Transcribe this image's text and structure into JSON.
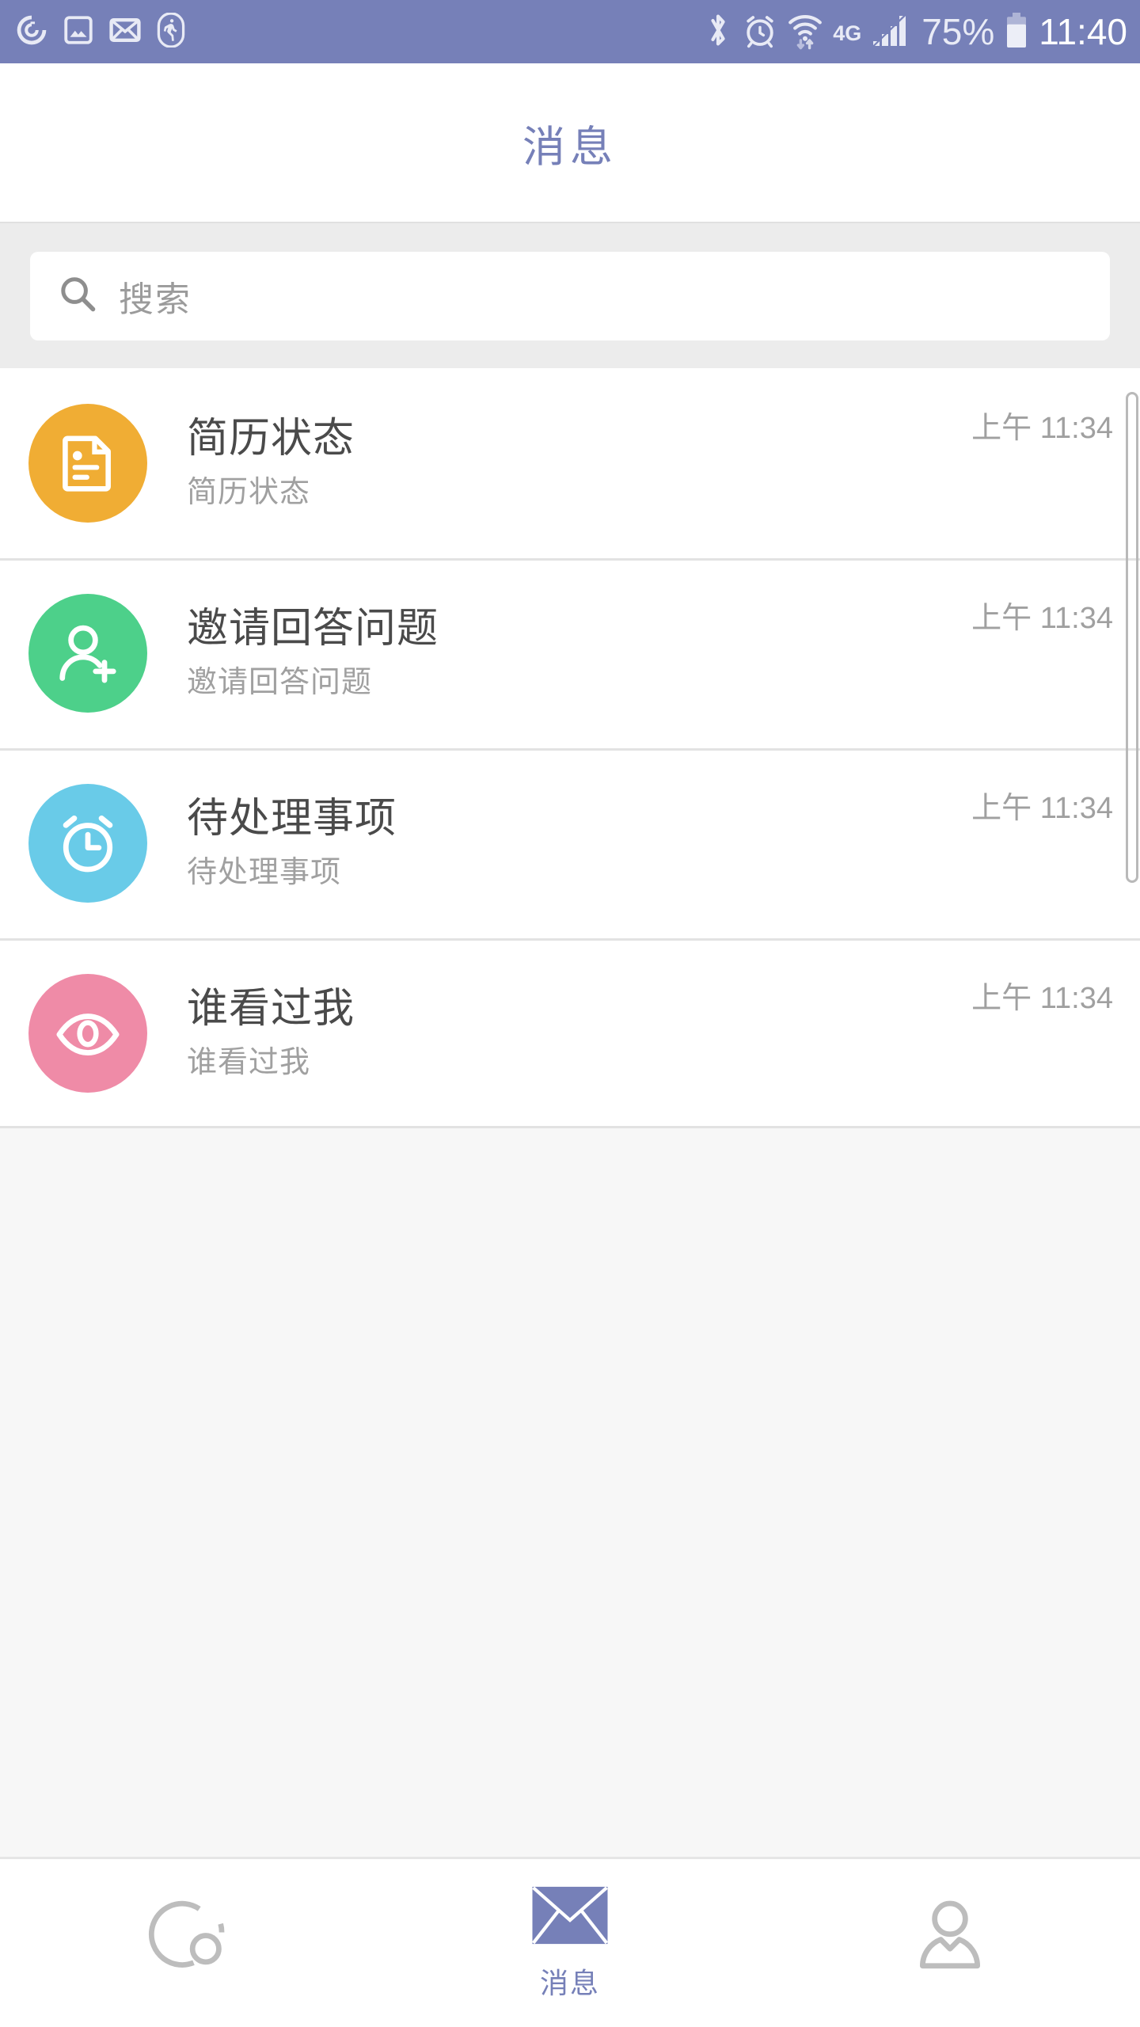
{
  "status_bar": {
    "background": "#7680b8",
    "left_icons": [
      {
        "name": "sync-icon",
        "label": "sync"
      },
      {
        "name": "screenshot-icon",
        "label": "screenshot"
      },
      {
        "name": "mail-icon",
        "label": "mail"
      },
      {
        "name": "pedometer-icon",
        "label": "pedometer"
      }
    ],
    "right_icons": [
      {
        "name": "bluetooth-icon",
        "label": "bluetooth"
      },
      {
        "name": "alarm-icon",
        "label": "alarm"
      },
      {
        "name": "wifi-icon",
        "label": "wifi"
      }
    ],
    "network": "4G",
    "battery_percent": "75%",
    "clock": "11:40"
  },
  "header": {
    "title": "消息"
  },
  "search": {
    "placeholder": "搜索",
    "value": "",
    "icon": "search-icon"
  },
  "list": {
    "items": [
      {
        "title": "简历状态",
        "subtitle": "简历状态",
        "time": "上午 11:34",
        "icon": "document-icon",
        "color": "#f0ad34"
      },
      {
        "title": "邀请回答问题",
        "subtitle": "邀请回答问题",
        "time": "上午 11:34",
        "icon": "person-add-icon",
        "color": "#4dd08a"
      },
      {
        "title": "待处理事项",
        "subtitle": "待处理事项",
        "time": "上午 11:34",
        "icon": "alarm-clock-icon",
        "color": "#69cbe8"
      },
      {
        "title": "谁看过我",
        "subtitle": "谁看过我",
        "time": "上午 11:34",
        "icon": "eye-icon",
        "color": "#ef8ba7"
      }
    ]
  },
  "bottom_nav": {
    "active_color": "#7680b8",
    "inactive_color": "#b5b5b5",
    "items": [
      {
        "label": "",
        "icon": "discover-icon",
        "active": false
      },
      {
        "label": "消息",
        "icon": "envelope-icon",
        "active": true
      },
      {
        "label": "",
        "icon": "profile-icon",
        "active": false
      }
    ]
  }
}
